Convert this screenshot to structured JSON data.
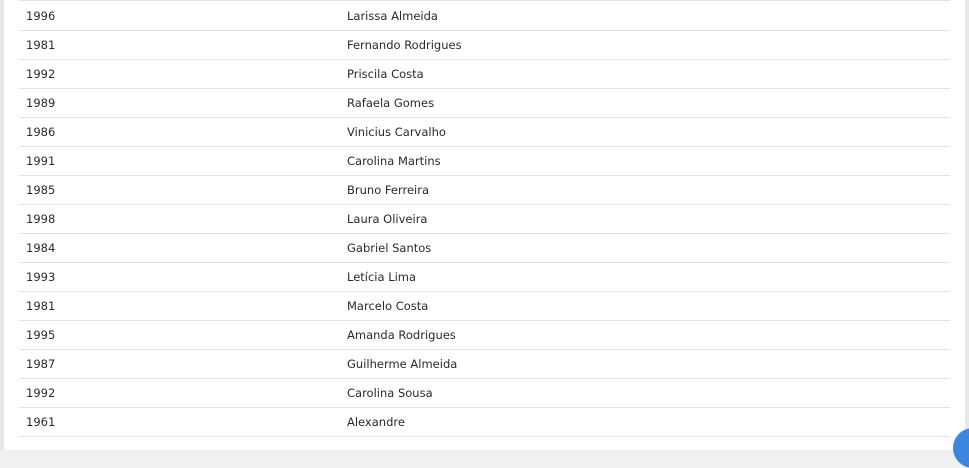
{
  "table": {
    "rows": [
      {
        "year": "1996",
        "name": "Larissa Almeida"
      },
      {
        "year": "1981",
        "name": "Fernando Rodrigues"
      },
      {
        "year": "1992",
        "name": "Priscila Costa"
      },
      {
        "year": "1989",
        "name": "Rafaela Gomes"
      },
      {
        "year": "1986",
        "name": "Vinicius Carvalho"
      },
      {
        "year": "1991",
        "name": "Carolina Martins"
      },
      {
        "year": "1985",
        "name": "Bruno Ferreira"
      },
      {
        "year": "1998",
        "name": "Laura Oliveira"
      },
      {
        "year": "1984",
        "name": "Gabriel Santos"
      },
      {
        "year": "1993",
        "name": "Letícia Lima"
      },
      {
        "year": "1981",
        "name": "Marcelo Costa"
      },
      {
        "year": "1995",
        "name": "Amanda Rodrigues"
      },
      {
        "year": "1987",
        "name": "Guilherme Almeida"
      },
      {
        "year": "1992",
        "name": "Carolina Sousa"
      },
      {
        "year": "1961",
        "name": "Alexandre"
      }
    ]
  },
  "colors": {
    "accent": "#3d86df",
    "divider": "#e3e3e3",
    "text": "#2a2a2a"
  },
  "fab": {
    "icon": "floating-action-button"
  }
}
